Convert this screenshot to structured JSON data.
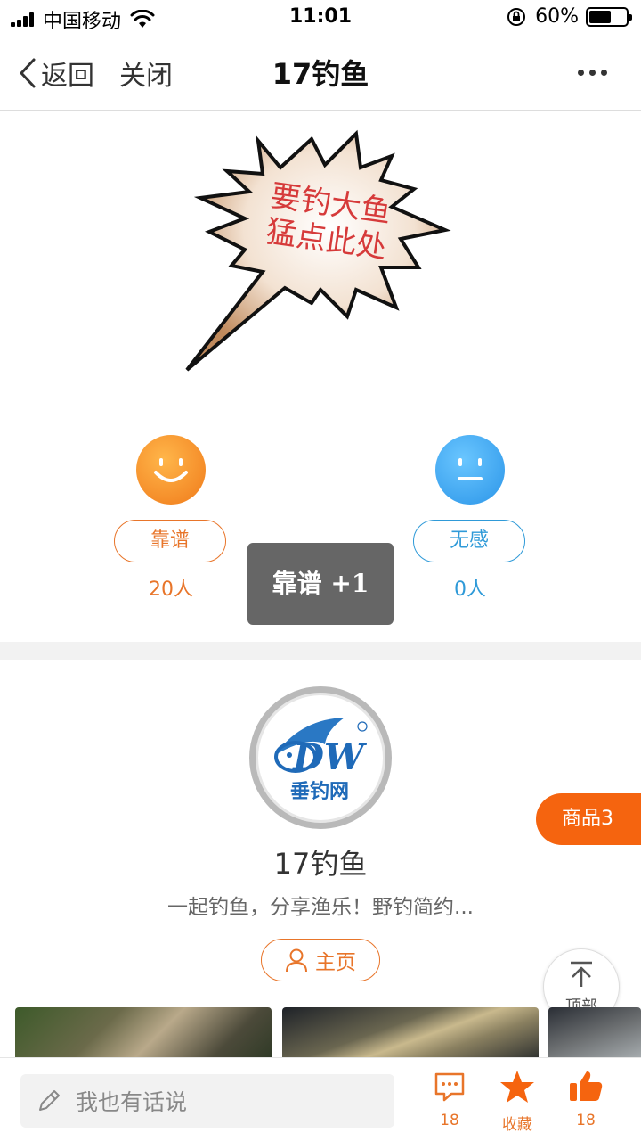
{
  "status": {
    "carrier": "中国移动",
    "time": "11:01",
    "battery": "60%"
  },
  "nav": {
    "back": "返回",
    "close": "关闭",
    "title": "17钓鱼"
  },
  "banner": {
    "line1": "要钓大鱼",
    "line2": "猛点此处"
  },
  "votes": {
    "good": {
      "label": "靠谱",
      "count": "20人"
    },
    "meh": {
      "label": "无感",
      "count": "0人"
    }
  },
  "toast": "靠谱 +1",
  "profile": {
    "name": "17钓鱼",
    "description": "一起钓鱼，分享渔乐！野钓简约...",
    "home": "主页",
    "logo_letters": "DW",
    "logo_text": "垂钓网"
  },
  "goods": "商品3",
  "to_top": "顶部",
  "bottom": {
    "placeholder": "我也有话说",
    "comments": "18",
    "favorite": "收藏",
    "likes": "18"
  },
  "colors": {
    "accent": "#e8752a",
    "blue": "#2f9ad8",
    "goods": "#f5640f"
  }
}
